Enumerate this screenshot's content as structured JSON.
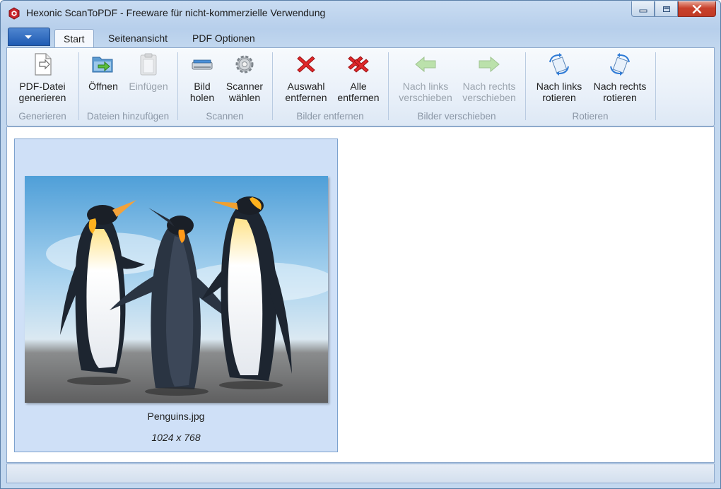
{
  "window": {
    "title": "Hexonic ScanToPDF - Freeware für nicht-kommerzielle Verwendung",
    "icon": "hexonic-logo-icon",
    "controls": [
      "minimize-icon",
      "maximize-icon",
      "close-icon"
    ]
  },
  "tabs": [
    {
      "label": "Start",
      "active": true
    },
    {
      "label": "Seitenansicht",
      "active": false
    },
    {
      "label": "PDF Optionen",
      "active": false
    }
  ],
  "ribbon": {
    "groups": [
      {
        "label": "Generieren",
        "buttons": [
          {
            "label": "PDF-Datei generieren",
            "line1": "PDF-Datei",
            "line2": "generieren",
            "icon": "pdf-document-icon",
            "enabled": true
          }
        ]
      },
      {
        "label": "Dateien hinzufügen",
        "buttons": [
          {
            "label": "Öffnen",
            "line1": "Öffnen",
            "line2": "",
            "icon": "folder-open-icon",
            "enabled": true
          },
          {
            "label": "Einfügen",
            "line1": "Einfügen",
            "line2": "",
            "icon": "clipboard-paste-icon",
            "enabled": false
          }
        ]
      },
      {
        "label": "Scannen",
        "buttons": [
          {
            "label": "Bild holen",
            "line1": "Bild",
            "line2": "holen",
            "icon": "scanner-icon",
            "enabled": true
          },
          {
            "label": "Scanner wählen",
            "line1": "Scanner",
            "line2": "wählen",
            "icon": "gear-icon",
            "enabled": true
          }
        ]
      },
      {
        "label": "Bilder entfernen",
        "buttons": [
          {
            "label": "Auswahl entfernen",
            "line1": "Auswahl",
            "line2": "entfernen",
            "icon": "red-x-icon",
            "enabled": true
          },
          {
            "label": "Alle entfernen",
            "line1": "Alle",
            "line2": "entfernen",
            "icon": "double-red-x-icon",
            "enabled": true
          }
        ]
      },
      {
        "label": "Bilder verschieben",
        "buttons": [
          {
            "label": "Nach links verschieben",
            "line1": "Nach links",
            "line2": "verschieben",
            "icon": "arrow-left-icon",
            "enabled": false
          },
          {
            "label": "Nach rechts verschieben",
            "line1": "Nach rechts",
            "line2": "verschieben",
            "icon": "arrow-right-icon",
            "enabled": false
          }
        ]
      },
      {
        "label": "Rotieren",
        "buttons": [
          {
            "label": "Nach links rotieren",
            "line1": "Nach links",
            "line2": "rotieren",
            "icon": "rotate-left-icon",
            "enabled": true
          },
          {
            "label": "Nach rechts rotieren",
            "line1": "Nach rechts",
            "line2": "rotieren",
            "icon": "rotate-right-icon",
            "enabled": true
          }
        ]
      }
    ]
  },
  "images": [
    {
      "filename": "Penguins.jpg",
      "dimensions": "1024 x 768",
      "selected": true
    }
  ],
  "colors": {
    "accent": "#1f5bb3",
    "ribbon_border": "#8da9cc",
    "selection": "#cfe0f7",
    "disabled_text": "#9aa3ad",
    "close_button": "#c8412c"
  }
}
